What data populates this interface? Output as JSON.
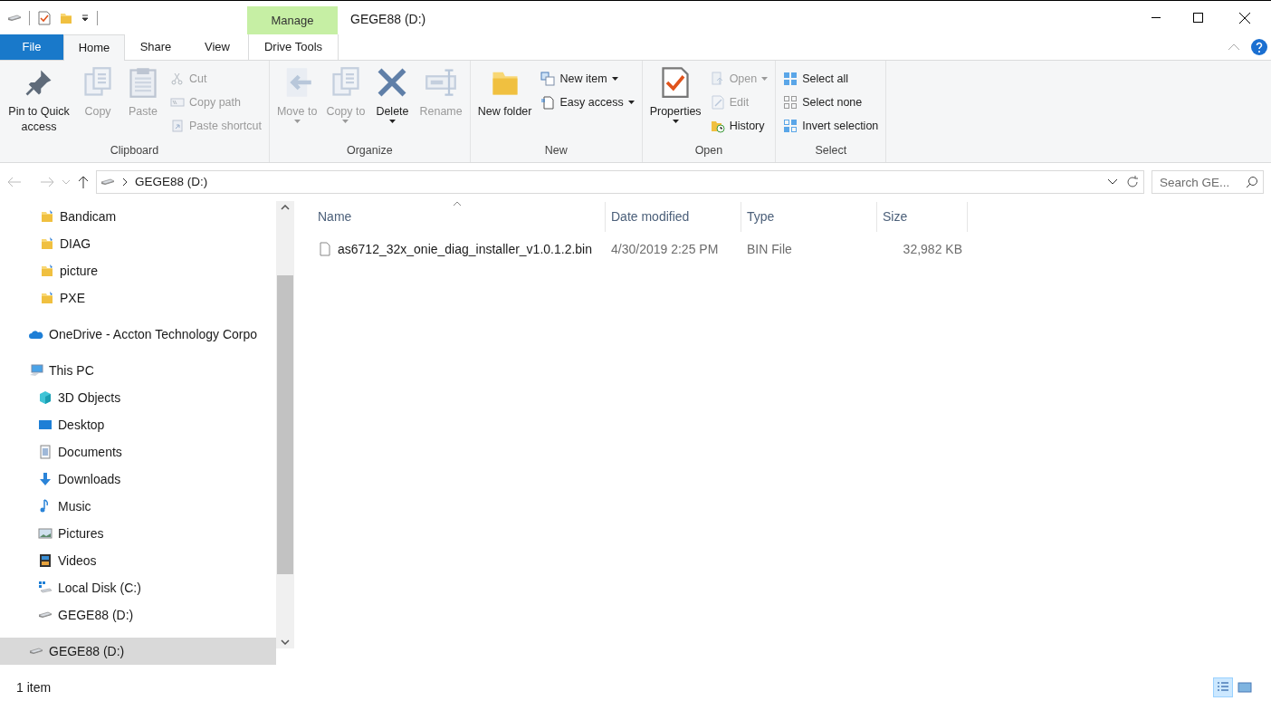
{
  "window": {
    "title": "GEGE88 (D:)",
    "context_tab_group": "Manage"
  },
  "tabs": [
    {
      "label": "File",
      "kind": "file",
      "selected": false
    },
    {
      "label": "Home",
      "kind": "normal",
      "selected": true
    },
    {
      "label": "Share",
      "kind": "normal",
      "selected": false
    },
    {
      "label": "View",
      "kind": "normal",
      "selected": false
    },
    {
      "label": "Drive Tools",
      "kind": "context",
      "selected": false
    }
  ],
  "ribbon": [
    {
      "label": "Clipboard",
      "buttons": [
        {
          "label": "Pin to Quick access",
          "kind": "large",
          "disabled": false
        },
        {
          "label": "Copy",
          "kind": "large",
          "disabled": true
        },
        {
          "label": "Paste",
          "kind": "large",
          "disabled": true
        },
        {
          "label": "Cut",
          "kind": "small",
          "disabled": true
        },
        {
          "label": "Copy path",
          "kind": "small",
          "disabled": true
        },
        {
          "label": "Paste shortcut",
          "kind": "small",
          "disabled": true
        }
      ]
    },
    {
      "label": "Organize",
      "buttons": [
        {
          "label": "Move to",
          "kind": "large-drop",
          "disabled": true
        },
        {
          "label": "Copy to",
          "kind": "large-drop",
          "disabled": true
        },
        {
          "label": "Delete",
          "kind": "large-drop",
          "disabled": false
        },
        {
          "label": "Rename",
          "kind": "large",
          "disabled": true
        }
      ]
    },
    {
      "label": "New",
      "buttons": [
        {
          "label": "New folder",
          "kind": "large",
          "disabled": false
        },
        {
          "label": "New item",
          "kind": "small-drop",
          "disabled": false
        },
        {
          "label": "Easy access",
          "kind": "small-drop",
          "disabled": false
        }
      ]
    },
    {
      "label": "Open",
      "buttons": [
        {
          "label": "Properties",
          "kind": "large-drop",
          "disabled": false
        },
        {
          "label": "Open",
          "kind": "small-drop",
          "disabled": true
        },
        {
          "label": "Edit",
          "kind": "small",
          "disabled": true
        },
        {
          "label": "History",
          "kind": "small",
          "disabled": false
        }
      ]
    },
    {
      "label": "Select",
      "buttons": [
        {
          "label": "Select all",
          "kind": "small",
          "disabled": false
        },
        {
          "label": "Select none",
          "kind": "small",
          "disabled": false
        },
        {
          "label": "Invert selection",
          "kind": "small",
          "disabled": false
        }
      ]
    }
  ],
  "address_bar": {
    "path": "GEGE88 (D:)",
    "search_placeholder": "Search GE..."
  },
  "nav_pane": {
    "partial_group": [
      {
        "label": "Bandicam",
        "kind": "pinned-folder",
        "selected": false
      },
      {
        "label": "DIAG",
        "kind": "pinned-folder",
        "selected": false
      },
      {
        "label": "picture",
        "kind": "pinned-folder",
        "selected": false
      },
      {
        "label": "PXE",
        "kind": "pinned-folder",
        "selected": false
      }
    ],
    "items": [
      {
        "label": "OneDrive - Accton Technology Corpo",
        "kind": "cloud",
        "selected": false
      },
      {
        "label": "This PC",
        "kind": "pc",
        "selected": false,
        "children": [
          {
            "label": "3D Objects",
            "kind": "cube",
            "selected": false
          },
          {
            "label": "Desktop",
            "kind": "desktop",
            "selected": false
          },
          {
            "label": "Documents",
            "kind": "document",
            "selected": false
          },
          {
            "label": "Downloads",
            "kind": "download",
            "selected": false
          },
          {
            "label": "Music",
            "kind": "music",
            "selected": false
          },
          {
            "label": "Pictures",
            "kind": "pictures",
            "selected": false
          },
          {
            "label": "Videos",
            "kind": "videos",
            "selected": false
          },
          {
            "label": "Local Disk (C:)",
            "kind": "windisk",
            "selected": false
          },
          {
            "label": "GEGE88 (D:)",
            "kind": "drive",
            "selected": false
          }
        ]
      },
      {
        "label": "GEGE88 (D:)",
        "kind": "drive",
        "selected": true
      }
    ]
  },
  "file_list": {
    "columns": [
      "Name",
      "Date modified",
      "Type",
      "Size"
    ],
    "rows": [
      {
        "name": "as6712_32x_onie_diag_installer_v1.0.1.2.bin",
        "date_modified": "4/30/2019 2:25 PM",
        "type": "BIN File",
        "size": "32,982 KB",
        "selected": false
      }
    ]
  },
  "status_bar": {
    "count": "1 item",
    "views": [
      {
        "kind": "details",
        "selected": true
      },
      {
        "kind": "large-icons",
        "selected": false
      }
    ]
  }
}
